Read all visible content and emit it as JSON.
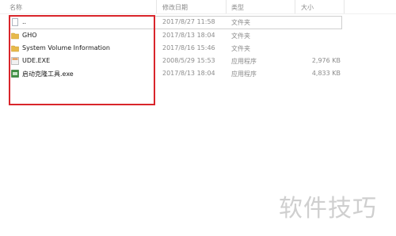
{
  "columns": {
    "name": "名称",
    "modified": "修改日期",
    "type": "类型",
    "size": "大小"
  },
  "files": [
    {
      "name": "..",
      "modified": "2017/8/27 11:58",
      "type": "文件夹",
      "size": "",
      "icon": "blank-file-icon"
    },
    {
      "name": "GHO",
      "modified": "2017/8/13 18:04",
      "type": "文件夹",
      "size": "",
      "icon": "folder-icon"
    },
    {
      "name": "System Volume Information",
      "modified": "2017/8/16 15:46",
      "type": "文件夹",
      "size": "",
      "icon": "folder-icon"
    },
    {
      "name": "UDE.EXE",
      "modified": "2008/5/29 15:53",
      "type": "应用程序",
      "size": "2,976 KB",
      "icon": "exe-icon"
    },
    {
      "name": "启动克隆工具.exe",
      "modified": "2017/8/13 18:04",
      "type": "应用程序",
      "size": "4,833 KB",
      "icon": "app-icon"
    }
  ],
  "watermark": "软件技巧",
  "colors": {
    "highlight": "#d9252b",
    "folder": "#e8b94a"
  }
}
